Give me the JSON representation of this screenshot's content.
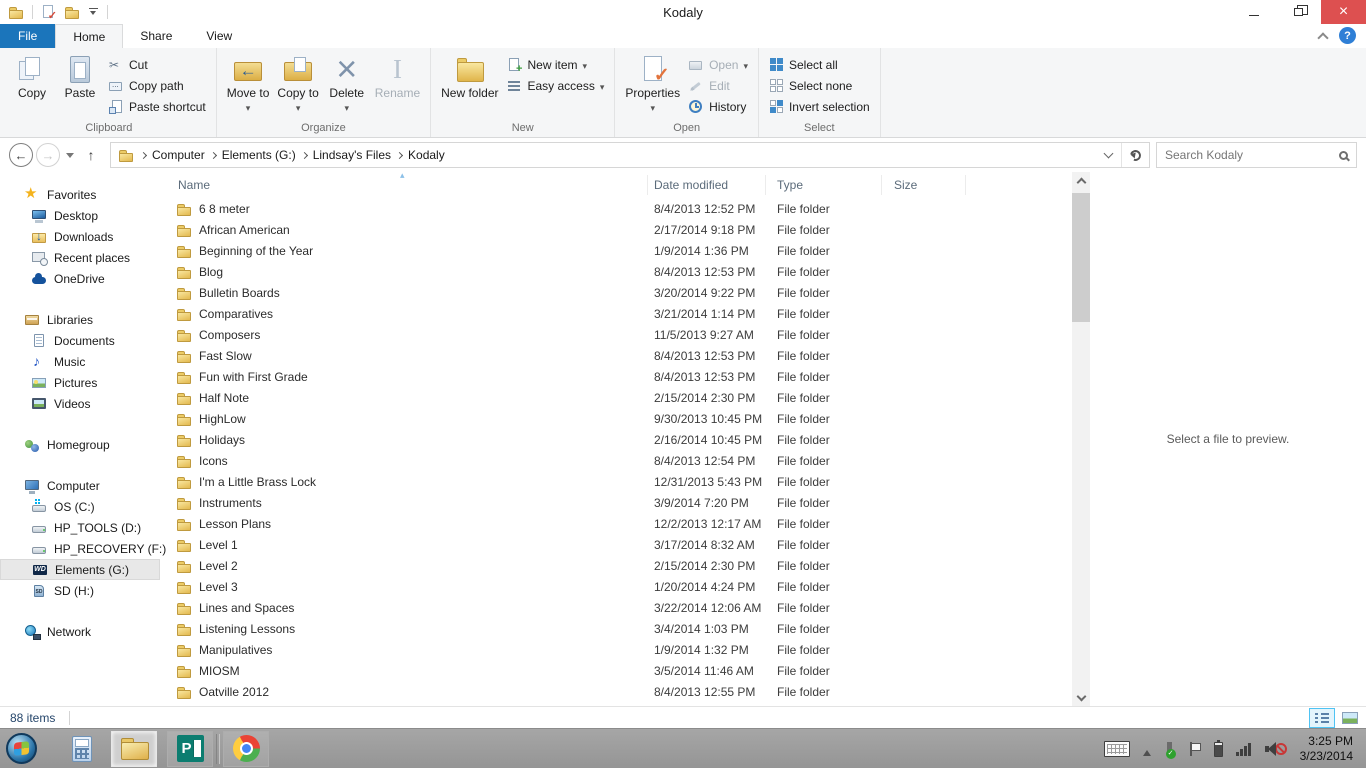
{
  "window": {
    "title": "Kodaly"
  },
  "tabs": {
    "file": "File",
    "home": "Home",
    "share": "Share",
    "view": "View"
  },
  "ribbon": {
    "clipboard": {
      "label": "Clipboard",
      "copy": "Copy",
      "paste": "Paste",
      "cut": "Cut",
      "copy_path": "Copy path",
      "paste_shortcut": "Paste shortcut"
    },
    "organize": {
      "label": "Organize",
      "move_to": "Move to",
      "copy_to": "Copy to",
      "delete": "Delete",
      "rename": "Rename"
    },
    "new": {
      "label": "New",
      "new_folder": "New folder",
      "new_item": "New item",
      "easy_access": "Easy access"
    },
    "open": {
      "label": "Open",
      "properties": "Properties",
      "open": "Open",
      "edit": "Edit",
      "history": "History"
    },
    "select": {
      "label": "Select",
      "select_all": "Select all",
      "select_none": "Select none",
      "invert_selection": "Invert selection"
    }
  },
  "address": {
    "breadcrumb": [
      "Computer",
      "Elements (G:)",
      "Lindsay's Files",
      "Kodaly"
    ],
    "search_placeholder": "Search Kodaly"
  },
  "sidebar": {
    "sections": [
      {
        "icon": "star",
        "label": "Favorites",
        "items": [
          {
            "icon": "desktop",
            "label": "Desktop"
          },
          {
            "icon": "downloads",
            "label": "Downloads"
          },
          {
            "icon": "recent",
            "label": "Recent places"
          },
          {
            "icon": "onedrive",
            "label": "OneDrive"
          }
        ]
      },
      {
        "icon": "libraries",
        "label": "Libraries",
        "items": [
          {
            "icon": "documents",
            "label": "Documents"
          },
          {
            "icon": "music",
            "label": "Music"
          },
          {
            "icon": "pictures",
            "label": "Pictures"
          },
          {
            "icon": "videos",
            "label": "Videos"
          }
        ]
      },
      {
        "icon": "homegroup",
        "label": "Homegroup",
        "items": []
      },
      {
        "icon": "computer",
        "label": "Computer",
        "items": [
          {
            "icon": "drive-os",
            "label": "OS (C:)"
          },
          {
            "icon": "drive",
            "label": "HP_TOOLS (D:)"
          },
          {
            "icon": "drive",
            "label": "HP_RECOVERY (F:)"
          },
          {
            "icon": "drive-wd",
            "label": "Elements (G:)",
            "selected": true
          },
          {
            "icon": "sd",
            "label": "SD (H:)"
          }
        ]
      },
      {
        "icon": "network",
        "label": "Network",
        "items": []
      }
    ]
  },
  "files": {
    "columns": [
      "Name",
      "Date modified",
      "Type",
      "Size"
    ],
    "rows": [
      {
        "name": "6 8 meter",
        "date": "8/4/2013 12:52 PM",
        "type": "File folder"
      },
      {
        "name": "African American",
        "date": "2/17/2014 9:18 PM",
        "type": "File folder"
      },
      {
        "name": "Beginning of the Year",
        "date": "1/9/2014 1:36 PM",
        "type": "File folder"
      },
      {
        "name": "Blog",
        "date": "8/4/2013 12:53 PM",
        "type": "File folder"
      },
      {
        "name": "Bulletin Boards",
        "date": "3/20/2014 9:22 PM",
        "type": "File folder"
      },
      {
        "name": "Comparatives",
        "date": "3/21/2014 1:14 PM",
        "type": "File folder"
      },
      {
        "name": "Composers",
        "date": "11/5/2013 9:27 AM",
        "type": "File folder"
      },
      {
        "name": "Fast Slow",
        "date": "8/4/2013 12:53 PM",
        "type": "File folder"
      },
      {
        "name": "Fun with First Grade",
        "date": "8/4/2013 12:53 PM",
        "type": "File folder"
      },
      {
        "name": "Half Note",
        "date": "2/15/2014 2:30 PM",
        "type": "File folder"
      },
      {
        "name": "HighLow",
        "date": "9/30/2013 10:45 PM",
        "type": "File folder"
      },
      {
        "name": "Holidays",
        "date": "2/16/2014 10:45 PM",
        "type": "File folder"
      },
      {
        "name": "Icons",
        "date": "8/4/2013 12:54 PM",
        "type": "File folder"
      },
      {
        "name": "I'm a Little Brass Lock",
        "date": "12/31/2013 5:43 PM",
        "type": "File folder"
      },
      {
        "name": "Instruments",
        "date": "3/9/2014 7:20 PM",
        "type": "File folder"
      },
      {
        "name": "Lesson Plans",
        "date": "12/2/2013 12:17 AM",
        "type": "File folder"
      },
      {
        "name": "Level 1",
        "date": "3/17/2014 8:32 AM",
        "type": "File folder"
      },
      {
        "name": "Level 2",
        "date": "2/15/2014 2:30 PM",
        "type": "File folder"
      },
      {
        "name": "Level 3",
        "date": "1/20/2014 4:24 PM",
        "type": "File folder"
      },
      {
        "name": "Lines and Spaces",
        "date": "3/22/2014 12:06 AM",
        "type": "File folder"
      },
      {
        "name": "Listening Lessons",
        "date": "3/4/2014 1:03 PM",
        "type": "File folder"
      },
      {
        "name": "Manipulatives",
        "date": "1/9/2014 1:32 PM",
        "type": "File folder"
      },
      {
        "name": "MIOSM",
        "date": "3/5/2014 11:46 AM",
        "type": "File folder"
      },
      {
        "name": "Oatville 2012",
        "date": "8/4/2013 12:55 PM",
        "type": "File folder"
      }
    ]
  },
  "preview": {
    "message": "Select a file to preview."
  },
  "status": {
    "items_count": "88 items"
  },
  "taskbar": {
    "clock_time": "3:25 PM",
    "clock_date": "3/23/2014"
  },
  "colors": {
    "accent_blue": "#1b75bb",
    "close_red": "#dd5050",
    "folder_yellow": "#e3b94f",
    "taskbar_gray": "#9c9c9c"
  }
}
